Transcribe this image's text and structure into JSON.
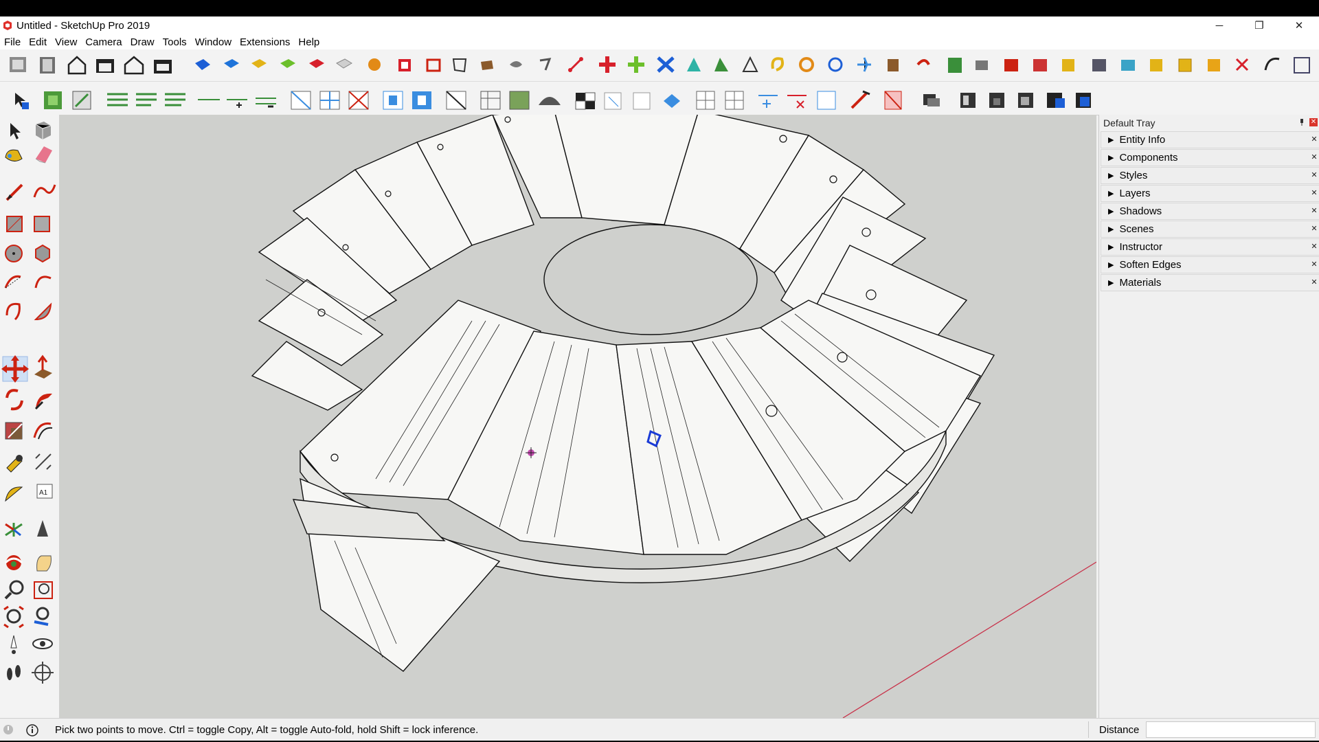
{
  "window": {
    "title": "Untitled - SketchUp Pro 2019",
    "controls": {
      "minimize": "─",
      "restore": "❐",
      "close": "✕"
    }
  },
  "menu": [
    "File",
    "Edit",
    "View",
    "Camera",
    "Draw",
    "Tools",
    "Window",
    "Extensions",
    "Help"
  ],
  "tray": {
    "title": "Default Tray",
    "panels": [
      "Entity Info",
      "Components",
      "Styles",
      "Layers",
      "Shadows",
      "Scenes",
      "Instructor",
      "Soften Edges",
      "Materials"
    ]
  },
  "status": {
    "hint": "Pick two points to move.  Ctrl = toggle Copy, Alt = toggle Auto-fold, hold Shift = lock inference.",
    "measure_label": "Distance",
    "measure_value": ""
  },
  "colors": {
    "accent": "#d9342b",
    "axis_red": "#c8324a",
    "selection": "#1a3bd6"
  },
  "toolbars": {
    "large_tool_set_icons": [
      "select-icon",
      "make-component-icon",
      "paint-bucket-icon",
      "eraser-icon",
      "line-icon",
      "freehand-icon",
      "rectangle-icon",
      "rotated-rectangle-icon",
      "circle-icon",
      "polygon-icon",
      "arc-icon",
      "two-point-arc-icon",
      "three-point-arc-icon",
      "pie-icon",
      "move-icon",
      "push-pull-icon",
      "rotate-icon",
      "follow-me-icon",
      "scale-icon",
      "offset-icon",
      "tape-measure-icon",
      "dimension-icon",
      "protractor-icon",
      "text-icon",
      "axes-icon",
      "3d-text-icon",
      "orbit-icon",
      "pan-icon",
      "zoom-icon",
      "zoom-window-icon",
      "zoom-extents-icon",
      "previous-view-icon",
      "position-camera-icon",
      "look-around-icon",
      "walk-icon",
      "section-plane-icon"
    ]
  }
}
